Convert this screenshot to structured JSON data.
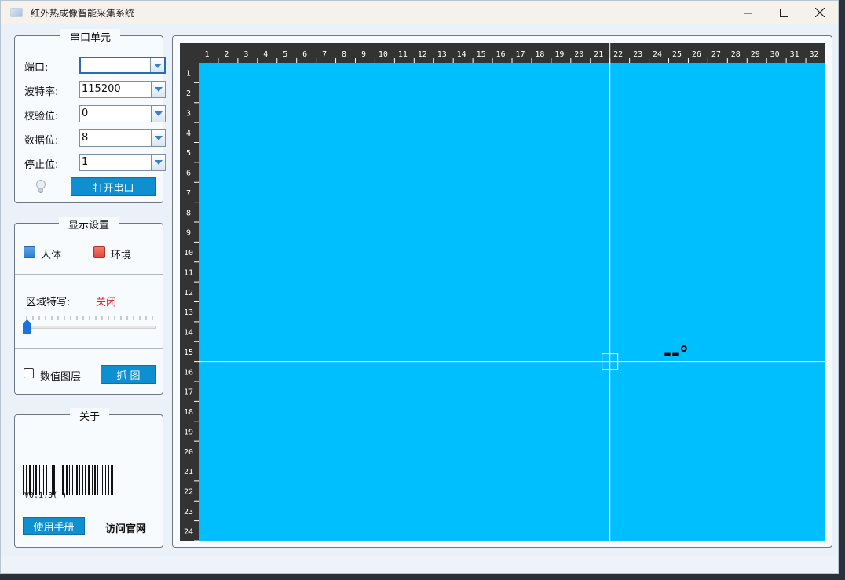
{
  "window": {
    "title": "红外热成像智能采集系统",
    "buttons": {
      "minimize": "─",
      "maximize": "☐",
      "close": "✕"
    }
  },
  "serial": {
    "title": "串口单元",
    "port_label": "端口:",
    "port_value": "",
    "baud_label": "波特率:",
    "baud_value": "115200",
    "parity_label": "校验位:",
    "parity_value": "0",
    "databits_label": "数据位:",
    "databits_value": "8",
    "stopbits_label": "停止位:",
    "stopbits_value": "1",
    "open_button": "打开串口"
  },
  "display": {
    "title": "显示设置",
    "human_label": "人体",
    "env_label": "环境",
    "zoom_label": "区域特写:",
    "zoom_status": "关闭",
    "zoom_level": 0,
    "data_layer_label": "数值图层",
    "data_layer_checked": false,
    "capture_button": "抓 图"
  },
  "about": {
    "title": "关于",
    "barcode_text": "V0.1.3( )",
    "manual_button": "使用手册",
    "website_link": "访问官网"
  },
  "heatmap": {
    "background": "#00BFFF",
    "columns": [
      "1",
      "2",
      "3",
      "4",
      "5",
      "6",
      "7",
      "8",
      "9",
      "10",
      "11",
      "12",
      "13",
      "14",
      "15",
      "16",
      "17",
      "18",
      "19",
      "20",
      "21",
      "22",
      "23",
      "24",
      "25",
      "26",
      "27",
      "28",
      "29",
      "30",
      "31",
      "32"
    ],
    "rows": [
      "1",
      "2",
      "3",
      "4",
      "5",
      "6",
      "7",
      "8",
      "9",
      "10",
      "11",
      "12",
      "13",
      "14",
      "15",
      "16",
      "17",
      "18",
      "19",
      "20",
      "21",
      "22",
      "23",
      "24"
    ],
    "readout": "--°",
    "crosshair_col": "22",
    "crosshair_row": "16"
  },
  "colors": {
    "accent": "#0d8fd0",
    "human": "#2f7fd0",
    "environment": "#e0453a",
    "status_off": "#e02020",
    "heatmap_bg": "#00BFFF",
    "ruler_bg": "#333333"
  }
}
